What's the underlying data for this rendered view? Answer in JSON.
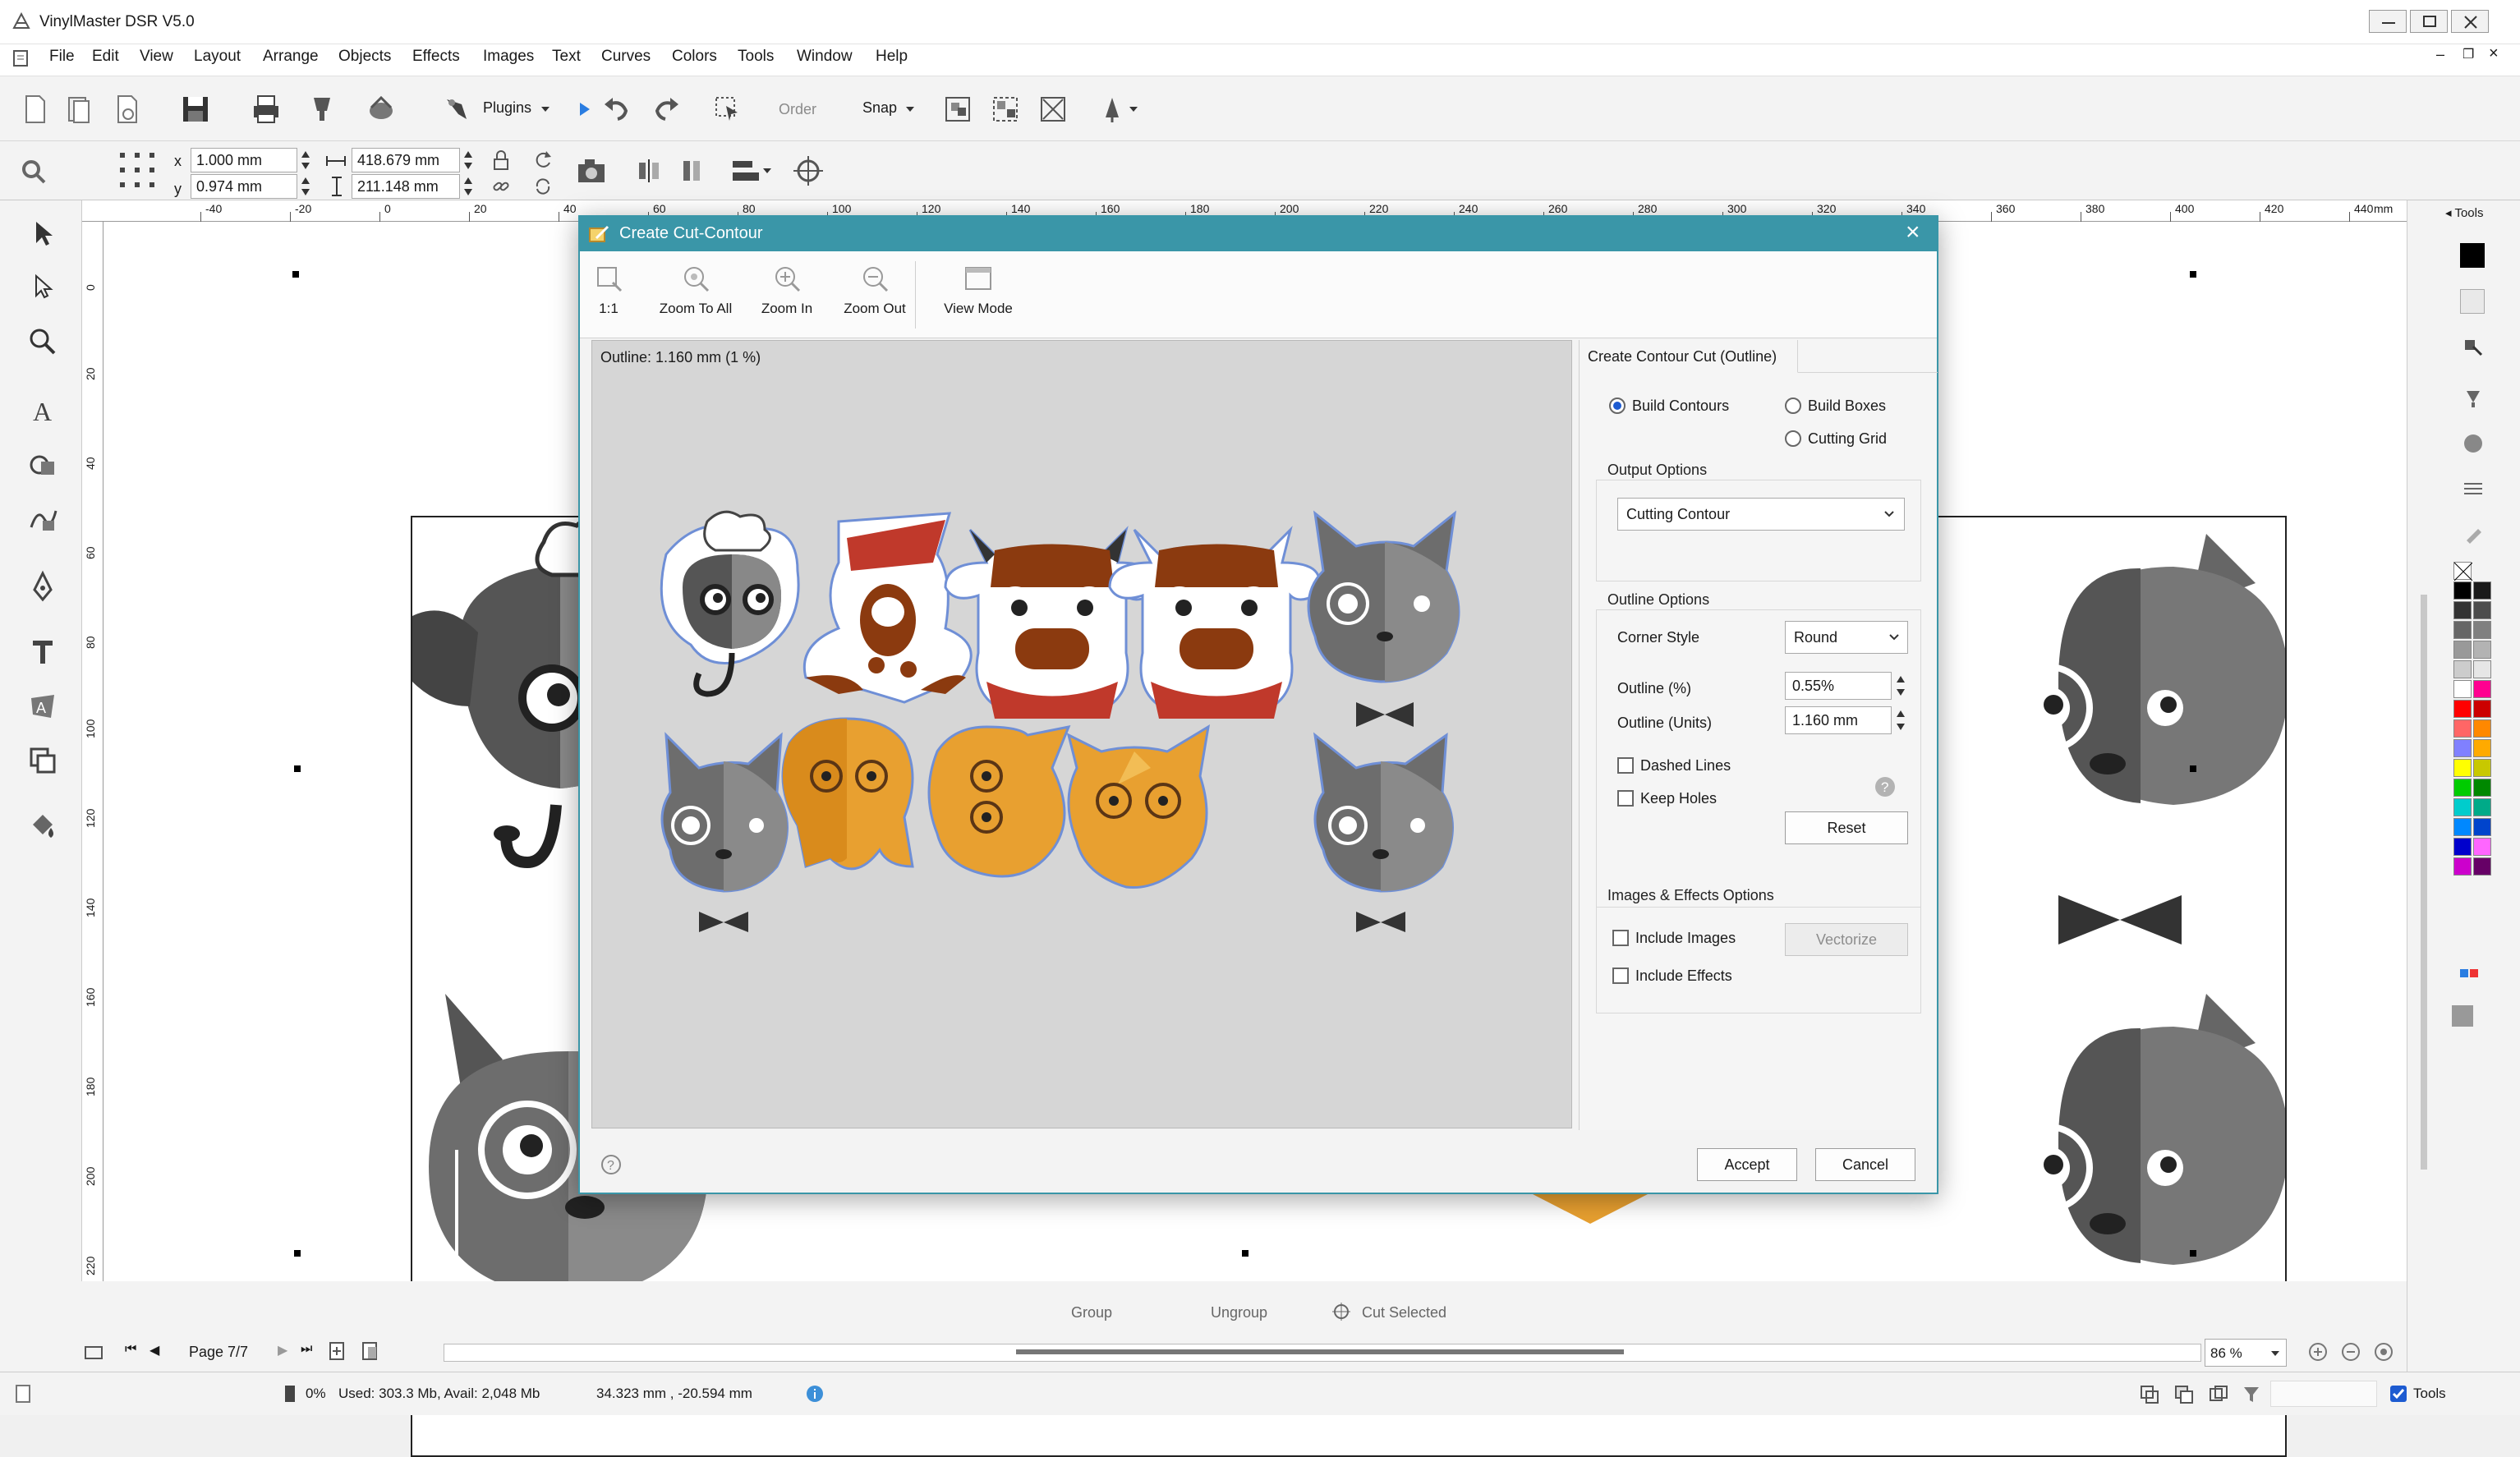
{
  "app": {
    "title": "VinylMaster DSR V5.0"
  },
  "menu": [
    "File",
    "Edit",
    "View",
    "Layout",
    "Arrange",
    "Objects",
    "Effects",
    "Images",
    "Text",
    "Curves",
    "Colors",
    "Tools",
    "Window",
    "Help"
  ],
  "toolbar": {
    "plugins_label": "Plugins",
    "order_label": "Order",
    "snap_label": "Snap"
  },
  "transform": {
    "x_label": "x",
    "y_label": "y",
    "x_value": "1.000 mm",
    "y_value": "0.974 mm",
    "width_value": "418.679 mm",
    "height_value": "211.148 mm"
  },
  "ruler": {
    "h_ticks": [
      "-40",
      "-20",
      "0",
      "20",
      "40",
      "60",
      "80",
      "100",
      "120",
      "140",
      "160",
      "180",
      "200",
      "220",
      "240",
      "260",
      "280",
      "300",
      "320",
      "340",
      "360",
      "380",
      "400",
      "420",
      "440"
    ],
    "h_unit": "mm",
    "v_ticks": [
      "0",
      "20",
      "40",
      "60",
      "80",
      "100",
      "120",
      "140",
      "160",
      "180",
      "200",
      "220"
    ]
  },
  "right_panel": {
    "tab_label": "Tools"
  },
  "dialog": {
    "title": "Create Cut-Contour",
    "toolbar": [
      {
        "label": "1:1",
        "icon": "zoom-actual-icon"
      },
      {
        "label": "Zoom To All",
        "icon": "zoom-all-icon"
      },
      {
        "label": "Zoom In",
        "icon": "zoom-in-icon"
      },
      {
        "label": "Zoom Out",
        "icon": "zoom-out-icon"
      },
      {
        "label": "View Mode",
        "icon": "view-mode-icon"
      }
    ],
    "preview_info": "Outline: 1.160 mm (1 %)",
    "options_tab": "Create Contour Cut (Outline)",
    "mode": {
      "build_contours": "Build Contours",
      "build_boxes": "Build Boxes",
      "cutting_grid": "Cutting Grid",
      "selected": "build_contours"
    },
    "output_options": {
      "title": "Output Options",
      "value": "Cutting Contour"
    },
    "outline_options": {
      "title": "Outline Options",
      "corner_style_label": "Corner Style",
      "corner_style_value": "Round",
      "outline_pct_label": "Outline (%)",
      "outline_pct_value": "0.55%",
      "outline_units_label": "Outline (Units)",
      "outline_units_value": "1.160 mm",
      "dashed_lines_label": "Dashed Lines",
      "dashed_lines_checked": false,
      "keep_holes_label": "Keep Holes",
      "keep_holes_checked": false,
      "reset_label": "Reset"
    },
    "images_effects": {
      "title": "Images & Effects Options",
      "include_images_label": "Include Images",
      "include_images_checked": false,
      "include_effects_label": "Include Effects",
      "include_effects_checked": false,
      "vectorize_label": "Vectorize"
    },
    "accept_label": "Accept",
    "cancel_label": "Cancel"
  },
  "bottom": {
    "group_label": "Group",
    "ungroup_label": "Ungroup",
    "cut_selected_label": "Cut Selected",
    "page_label": "Page 7/7",
    "zoom_value": "86 %"
  },
  "status": {
    "progress": "0%",
    "memory": "Used: 303.3 Mb, Avail: 2,048 Mb",
    "coords": "34.323 mm , -20.594 mm",
    "tools_label": "Tools"
  },
  "palette": [
    "#000000",
    "#1a1a1a",
    "#333333",
    "#4d4d4d",
    "#666666",
    "#808080",
    "#999999",
    "#b3b3b3",
    "#cccccc",
    "#e6e6e6",
    "#ffffff",
    "#ff0090",
    "#ff0000",
    "#cc0000",
    "#ff6666",
    "#ff8800",
    "#8080ff",
    "#ffaa00",
    "#ffff00",
    "#c8c800",
    "#00cc00",
    "#008800",
    "#00cccc",
    "#00aa88",
    "#0088ff",
    "#0044cc",
    "#0000cc",
    "#ff66ff",
    "#cc00cc",
    "#660066",
    "#000000",
    "#222222"
  ],
  "colors": {
    "accent": "#3a96a8",
    "cat": "#6e6e6e",
    "cow_red": "#c0392b",
    "cow_brown": "#8b3a0f",
    "fox": "#e8a030",
    "contour": "#6f8fd6"
  }
}
